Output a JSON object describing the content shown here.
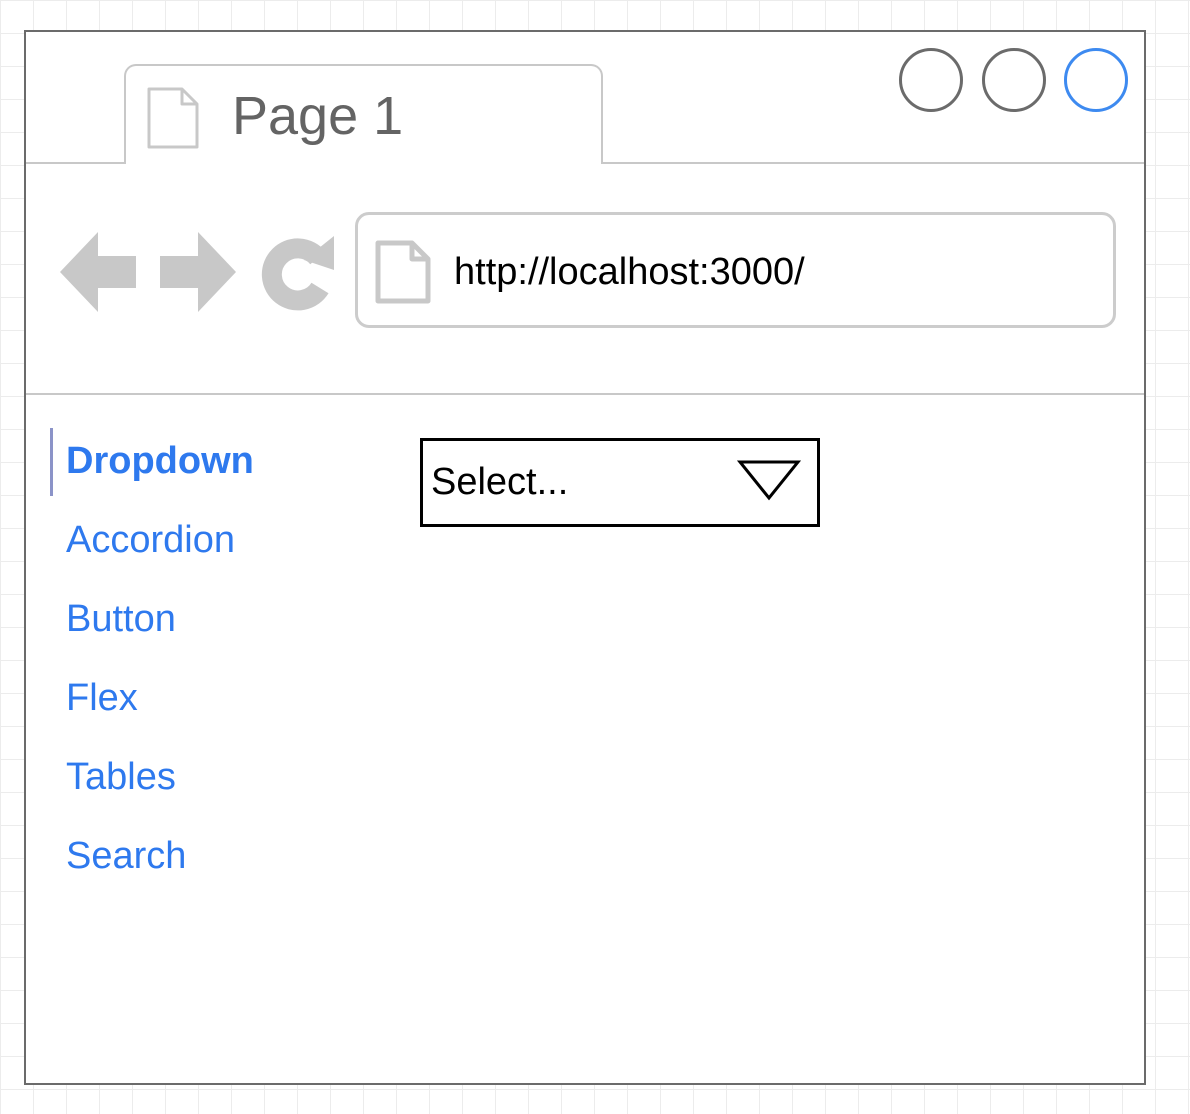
{
  "browser": {
    "tab": {
      "title": "Page 1",
      "icon": "document-icon"
    },
    "window_controls": [
      "minimize-icon",
      "maximize-icon",
      "close-icon"
    ],
    "toolbar": {
      "icons": [
        "back-arrow-icon",
        "forward-arrow-icon",
        "refresh-icon"
      ],
      "address": "http://localhost:3000/"
    }
  },
  "sidenav": {
    "items": [
      {
        "label": "Dropdown",
        "active": true
      },
      {
        "label": "Accordion",
        "active": false
      },
      {
        "label": "Button",
        "active": false
      },
      {
        "label": "Flex",
        "active": false
      },
      {
        "label": "Tables",
        "active": false
      },
      {
        "label": "Search",
        "active": false
      }
    ]
  },
  "main": {
    "dropdown": {
      "value": "Select...",
      "icon": "triangle-down-icon"
    }
  },
  "colors": {
    "link": "#2e79ee",
    "close_button": "#3d8af0",
    "active_indicator": "#8b93c8",
    "chrome_gray": "#c8c8c8"
  }
}
